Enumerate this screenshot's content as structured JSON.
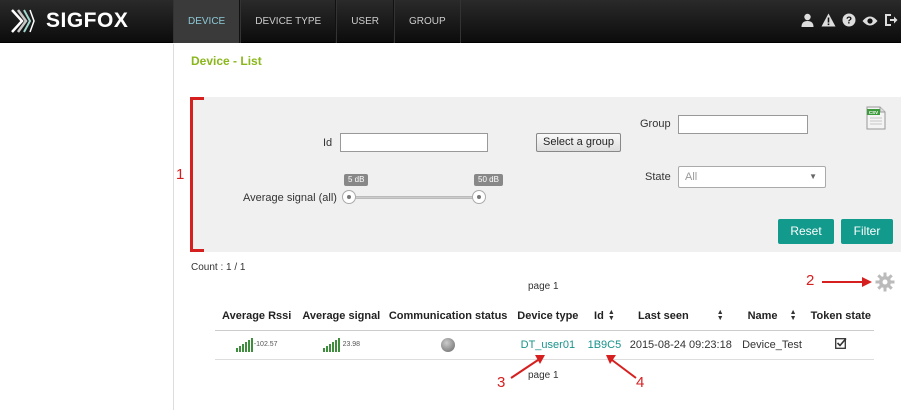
{
  "header": {
    "brand": "SIGFOX",
    "nav": [
      {
        "label": "DEVICE",
        "active": true
      },
      {
        "label": "DEVICE TYPE",
        "active": false
      },
      {
        "label": "USER",
        "active": false
      },
      {
        "label": "GROUP",
        "active": false
      }
    ],
    "icons": [
      "user-icon",
      "warning-icon",
      "help-icon",
      "eye-icon",
      "logout-icon"
    ]
  },
  "page": {
    "title": "Device - List"
  },
  "filters": {
    "id_label": "Id",
    "id_value": "",
    "group_label": "Group",
    "group_value": "",
    "select_group_label": "Select a group",
    "state_label": "State",
    "state_selected": "All",
    "avg_signal_label": "Average signal (all)",
    "slider_min_label": "5 dB",
    "slider_max_label": "50 dB",
    "reset_label": "Reset",
    "filter_label": "Filter",
    "csv_label": "CSV"
  },
  "results": {
    "count": "Count : 1 / 1",
    "page_top": "page 1",
    "page_bottom": "page 1",
    "columns": [
      "Average Rssi",
      "Average signal",
      "Communication status",
      "Device type",
      "Id",
      "Last seen",
      "Name",
      "Token state"
    ],
    "rows": [
      {
        "avg_rssi": "-102.57",
        "avg_signal": "23.98",
        "device_type": "DT_user01",
        "id": "1B9C5",
        "last_seen": "2015-08-24 09:23:18",
        "name": "Device_Test"
      }
    ]
  },
  "annotations": {
    "a1": "1",
    "a2": "2",
    "a3": "3",
    "a4": "4"
  },
  "colors": {
    "accent": "#129a8d",
    "title": "#8ab71c",
    "annotation": "#d62020"
  }
}
